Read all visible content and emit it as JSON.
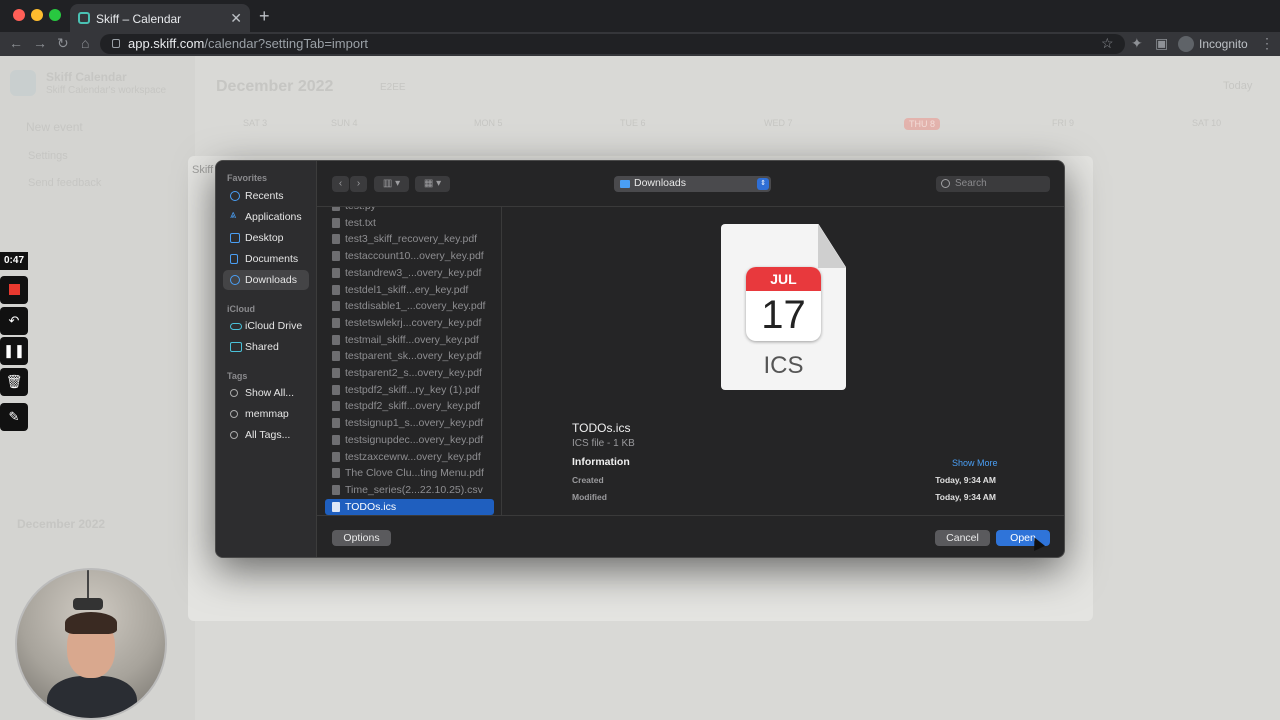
{
  "browser": {
    "tab_title": "Skiff – Calendar",
    "tab_close": "✕",
    "new_tab": "+",
    "url_host": "app.skiff.com",
    "url_path": "/calendar?settingTab=import",
    "incognito_label": "Incognito",
    "colors": {
      "close": "#ff5f57",
      "minimize": "#febc2e",
      "zoom": "#28c840"
    }
  },
  "skiff": {
    "app_name": "Skiff Calendar",
    "workspace": "Skiff Calendar's workspace",
    "new_event": "New event",
    "settings": "Settings",
    "send_feedback": "Send feedback",
    "month_title": "December 2022",
    "e2ee": "E2EE",
    "today": "Today",
    "days": [
      "SAT 3",
      "SUN 4",
      "MON 5",
      "TUE 6",
      "WED 7",
      "THU 8",
      "FRI 9",
      "SAT 10"
    ],
    "mini_month": "December 2022",
    "dialog_title": "Skiff"
  },
  "recorder": {
    "time": "0:47"
  },
  "dialog": {
    "sidebar": {
      "favorites_label": "Favorites",
      "favorites": [
        {
          "label": "Recents",
          "icon": "clock-icon"
        },
        {
          "label": "Applications",
          "icon": "applications-icon"
        },
        {
          "label": "Desktop",
          "icon": "desktop-icon"
        },
        {
          "label": "Documents",
          "icon": "document-icon"
        },
        {
          "label": "Downloads",
          "icon": "download-icon",
          "selected": true
        }
      ],
      "icloud_label": "iCloud",
      "icloud": [
        {
          "label": "iCloud Drive",
          "icon": "cloud-icon"
        },
        {
          "label": "Shared",
          "icon": "shared-folder-icon"
        }
      ],
      "tags_label": "Tags",
      "tags": [
        {
          "label": "Show All...",
          "icon": "tag-icon"
        },
        {
          "label": "memmap",
          "icon": "tag-icon"
        },
        {
          "label": "All Tags...",
          "icon": "tag-icon"
        }
      ]
    },
    "toolbar": {
      "location": "Downloads",
      "search_placeholder": "Search"
    },
    "files": [
      "test.py",
      "test.txt",
      "test3_skiff_recovery_key.pdf",
      "testaccount10...overy_key.pdf",
      "testandrew3_...overy_key.pdf",
      "testdel1_skiff...ery_key.pdf",
      "testdisable1_...covery_key.pdf",
      "testetswlekrj...covery_key.pdf",
      "testmail_skiff...overy_key.pdf",
      "testparent_sk...overy_key.pdf",
      "testparent2_s...overy_key.pdf",
      "testpdf2_skiff...ry_key (1).pdf",
      "testpdf2_skiff...overy_key.pdf",
      "testsignup1_s...overy_key.pdf",
      "testsignupdec...overy_key.pdf",
      "testzaxcewrw...overy_key.pdf",
      "The Clove Clu...ting Menu.pdf",
      "Time_series(2...22.10.25).csv",
      "TODOs.ics"
    ],
    "selected_file": "TODOs.ics",
    "preview": {
      "icon_month": "JUL",
      "icon_day": "17",
      "icon_ext": "ICS",
      "file_name": "TODOs.ics",
      "file_meta": "ICS file - 1 KB",
      "info_heading": "Information",
      "show_more": "Show More",
      "created_label": "Created",
      "created_value": "Today, 9:34 AM",
      "modified_label": "Modified",
      "modified_value": "Today, 9:34 AM"
    },
    "buttons": {
      "options": "Options",
      "cancel": "Cancel",
      "open": "Open"
    }
  }
}
